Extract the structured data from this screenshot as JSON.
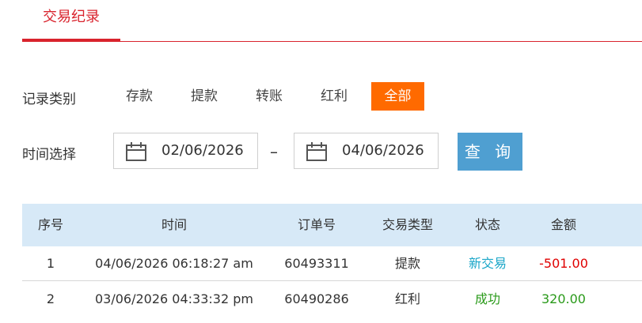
{
  "tabs": [
    {
      "label": "交易纪录",
      "active": true
    }
  ],
  "filters": {
    "category_label": "记录类别",
    "categories": [
      "存款",
      "提款",
      "转账",
      "红利",
      "全部"
    ],
    "selected_category": "全部",
    "time_label": "时间选择",
    "start_date": "02/06/2026",
    "end_date": "04/06/2026",
    "separator": "–",
    "query_label": "查 询"
  },
  "table": {
    "headers": [
      "序号",
      "时间",
      "订单号",
      "交易类型",
      "状态",
      "金额"
    ],
    "rows": [
      {
        "index": "1",
        "time": "04/06/2026 06:18:27 am",
        "order": "60493311",
        "type": "提款",
        "status": "新交易",
        "amount": "-501.00",
        "status_color": "#1aa6c8",
        "amount_color": "#e00000"
      },
      {
        "index": "2",
        "time": "03/06/2026 04:33:32 pm",
        "order": "60490286",
        "type": "红利",
        "status": "成功",
        "amount": "320.00",
        "status_color": "#2a9a1a",
        "amount_color": "#2a9a1a"
      }
    ]
  },
  "colors": {
    "accent": "#d9232d",
    "active_category": "#ff6a00",
    "query_button": "#4f9fd1",
    "table_header": "#d7e9f7"
  }
}
